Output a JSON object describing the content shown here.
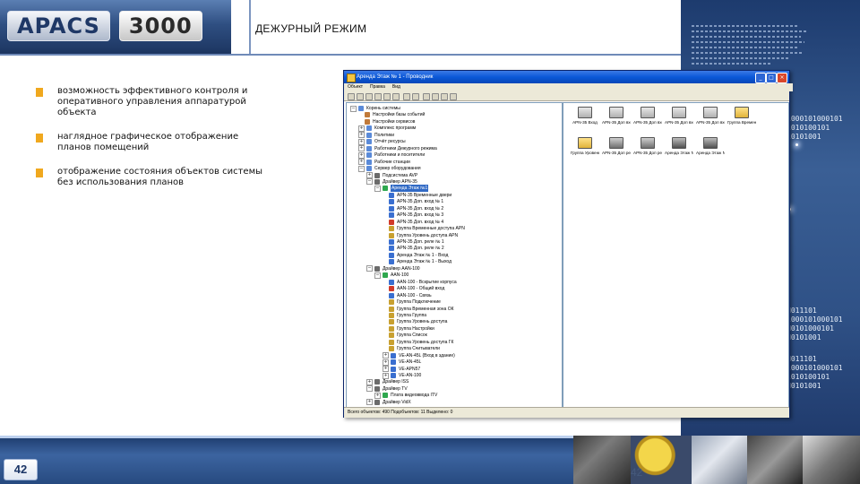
{
  "header": {
    "logo_apacs": "APACS",
    "logo_num": "3000",
    "title": "ДЕЖУРНЫЙ РЕЖИМ"
  },
  "bullets": [
    "возможность эффективного контроля и оперативного управления аппаратурой объекта",
    "наглядное графическое отображение планов помещений",
    "отображение состояния объектов системы без использования планов"
  ],
  "window": {
    "title": "Аренда Этаж № 1 - Проводник",
    "buttons": [
      "_",
      "□",
      "×"
    ],
    "menu": [
      "Объект",
      "Правка",
      "Вид"
    ],
    "tree": [
      {
        "label": "Корень системы",
        "level": 0,
        "expander": "−",
        "icon_color": "#5a8ad8"
      },
      {
        "label": "Настройки базы событий",
        "level": 1,
        "expander": "",
        "icon_color": "#c07a3a"
      },
      {
        "label": "Настройки сервисов",
        "level": 1,
        "expander": "",
        "icon_color": "#c07a3a"
      },
      {
        "label": "Комплекс программ",
        "level": 1,
        "expander": "+",
        "icon_color": "#5a8ad8"
      },
      {
        "label": "Политики",
        "level": 1,
        "expander": "+",
        "icon_color": "#5a8ad8"
      },
      {
        "label": "Отчёт ресурсы",
        "level": 1,
        "expander": "+",
        "icon_color": "#5a8ad8"
      },
      {
        "label": "Работники Дежурного режима",
        "level": 1,
        "expander": "+",
        "icon_color": "#5a8ad8"
      },
      {
        "label": "Работники и посетители",
        "level": 1,
        "expander": "+",
        "icon_color": "#5a8ad8"
      },
      {
        "label": "Рабочие станции",
        "level": 1,
        "expander": "+",
        "icon_color": "#5a8ad8"
      },
      {
        "label": "Сервер оборудования",
        "level": 1,
        "expander": "−",
        "icon_color": "#5a8ad8"
      },
      {
        "label": "Подсистема AVP",
        "level": 2,
        "expander": "+",
        "icon_color": "#6b6b6b"
      },
      {
        "label": "Драйвер APN-35",
        "level": 2,
        "expander": "−",
        "icon_color": "#6b6b6b"
      },
      {
        "label": "Аренда Этаж №1",
        "level": 3,
        "expander": "−",
        "icon_color": "#2fa84f",
        "selected": true
      },
      {
        "label": "APN-35 Временные двери",
        "level": 4,
        "expander": "",
        "icon_color": "#3a6fd0"
      },
      {
        "label": "APN-35 Доп. вход № 1",
        "level": 4,
        "expander": "",
        "icon_color": "#3a6fd0"
      },
      {
        "label": "APN-35 Доп. вход № 2",
        "level": 4,
        "expander": "",
        "icon_color": "#3a6fd0"
      },
      {
        "label": "APN-35 Доп. вход № 3",
        "level": 4,
        "expander": "",
        "icon_color": "#3a6fd0"
      },
      {
        "label": "APN-35 Доп. вход № 4",
        "level": 4,
        "expander": "",
        "icon_color": "#d13a2a"
      },
      {
        "label": "Группа Временные доступа APN",
        "level": 4,
        "expander": "",
        "icon_color": "#c8a030"
      },
      {
        "label": "Группа Уровень доступа APN",
        "level": 4,
        "expander": "",
        "icon_color": "#c8a030"
      },
      {
        "label": "APN-35 Доп. реле № 1",
        "level": 4,
        "expander": "",
        "icon_color": "#3a6fd0"
      },
      {
        "label": "APN-35 Доп. реле № 2",
        "level": 4,
        "expander": "",
        "icon_color": "#3a6fd0"
      },
      {
        "label": "Аренда Этаж № 1 - Вход",
        "level": 4,
        "expander": "",
        "icon_color": "#3a6fd0"
      },
      {
        "label": "Аренда Этаж № 1 - Выход",
        "level": 4,
        "expander": "",
        "icon_color": "#3a6fd0"
      },
      {
        "label": "Драйвер AAN-100",
        "level": 2,
        "expander": "−",
        "icon_color": "#6b6b6b"
      },
      {
        "label": "AAN-100",
        "level": 3,
        "expander": "−",
        "icon_color": "#2fa84f"
      },
      {
        "label": "AAN-100 - Вскрытие корпуса",
        "level": 4,
        "expander": "",
        "icon_color": "#3a6fd0"
      },
      {
        "label": "AAN-100 - Общий вход",
        "level": 4,
        "expander": "",
        "icon_color": "#d13a2a"
      },
      {
        "label": "AAN-100 - Связь",
        "level": 4,
        "expander": "",
        "icon_color": "#3a6fd0"
      },
      {
        "label": "Группа Подключение",
        "level": 4,
        "expander": "",
        "icon_color": "#c8a030"
      },
      {
        "label": "Группа Временная зона ОК",
        "level": 4,
        "expander": "",
        "icon_color": "#c8a030"
      },
      {
        "label": "Группа Группа",
        "level": 4,
        "expander": "",
        "icon_color": "#c8a030"
      },
      {
        "label": "Группа Уровень доступа",
        "level": 4,
        "expander": "",
        "icon_color": "#c8a030"
      },
      {
        "label": "Группа Настройки",
        "level": 4,
        "expander": "",
        "icon_color": "#c8a030"
      },
      {
        "label": "Группа Список",
        "level": 4,
        "expander": "",
        "icon_color": "#c8a030"
      },
      {
        "label": "Группа Уровень доступа ГК",
        "level": 4,
        "expander": "",
        "icon_color": "#c8a030"
      },
      {
        "label": "Группа Считыватели",
        "level": 4,
        "expander": "",
        "icon_color": "#c8a030"
      },
      {
        "label": "VE-AN-45L (Вход в здание)",
        "level": 4,
        "expander": "+",
        "icon_color": "#3a6fd0"
      },
      {
        "label": "VE-AN-45L",
        "level": 4,
        "expander": "+",
        "icon_color": "#3a6fd0"
      },
      {
        "label": "VE-APN57",
        "level": 4,
        "expander": "+",
        "icon_color": "#3a6fd0"
      },
      {
        "label": "VE-AN-100",
        "level": 4,
        "expander": "+",
        "icon_color": "#3a6fd0"
      },
      {
        "label": "Драйвер ISS",
        "level": 2,
        "expander": "+",
        "icon_color": "#6b6b6b"
      },
      {
        "label": "Драйвер TV",
        "level": 2,
        "expander": "−",
        "icon_color": "#6b6b6b"
      },
      {
        "label": "Плата видеоввода ITV",
        "level": 3,
        "expander": "+",
        "icon_color": "#2fa84f"
      },
      {
        "label": "Драйвер VidX",
        "level": 2,
        "expander": "+",
        "icon_color": "#6b6b6b"
      }
    ],
    "tiles": [
      {
        "label": "APN-35 Вход",
        "kind": "door"
      },
      {
        "label": "APN-35 Доп вход №1",
        "kind": "door"
      },
      {
        "label": "APN-35 Доп вход № 2",
        "kind": "door"
      },
      {
        "label": "APN-35 Доп вход № 3",
        "kind": "door"
      },
      {
        "label": "APN-35 Доп вход № 4",
        "kind": "door"
      },
      {
        "label": "Группа Временна",
        "kind": "folder"
      },
      {
        "label": "Группа Уровень",
        "kind": "folder"
      },
      {
        "label": "APN-35 Доп реле №1",
        "kind": "relay"
      },
      {
        "label": "APN-35 Доп реле №2",
        "kind": "relay"
      },
      {
        "label": "Аренда Этаж № 1 - Вход",
        "kind": "reader"
      },
      {
        "label": "Аренда Этаж № 1 - Выход",
        "kind": "reader"
      }
    ],
    "status": "Всего объектов: 490     Подобъектов: 11  Выделено: 0"
  },
  "colors": {
    "accent": "#f0a81e",
    "header_blue": "#2f4f82",
    "titlebar": "#0a58d8",
    "selection": "#316ac5"
  },
  "decor": {
    "binary_lines": [
      "1000101000101",
      "1010100101",
      "10101001",
      "",
      "",
      "",
      "",
      "",
      "",
      "",
      "",
      "",
      "",
      "",
      "",
      "",
      "",
      "",
      "",
      "",
      "",
      "",
      "",
      "",
      "",
      "",
      "",
      "",
      "N011101",
      "1000101000101",
      "N0101000101",
      "N0101001",
      "",
      "N011101",
      "1000101000101",
      "1010100101",
      "N0101001"
    ]
  },
  "footer": {
    "page_number": "42",
    "ghost_number": "42"
  }
}
